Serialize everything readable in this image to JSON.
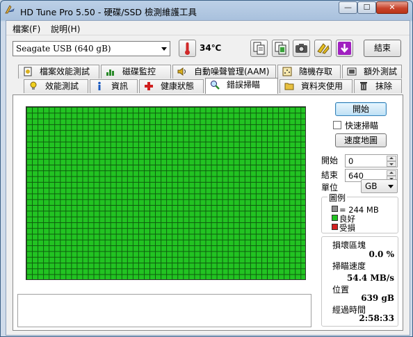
{
  "window": {
    "title": "HD Tune Pro 5.50 - 硬碟/SSD 檢測維護工具",
    "min_glyph": "—",
    "max_glyph": "☐",
    "close_glyph": "✕"
  },
  "menu": {
    "file": "檔案(F)",
    "help": "說明(H)"
  },
  "toolbar": {
    "drive": "Seagate USB (640 gB)",
    "temperature": "34℃",
    "exit": "結束",
    "icons": [
      "thermometer-icon",
      "copy-info-icon",
      "copy-screen-icon",
      "camera-icon",
      "options-icon",
      "download-icon"
    ]
  },
  "tabs": {
    "row_back": [
      "檔案效能測試",
      "磁碟監控",
      "自動噪聲管理(AAM)",
      "隨機存取",
      "額外測試"
    ],
    "row_front": [
      "效能測試",
      "資訊",
      "健康狀態",
      "錯誤掃瞄",
      "資料夾使用",
      "抹除"
    ],
    "active": "錯誤掃瞄"
  },
  "scan": {
    "start_button": "開始",
    "quick_scan_label": "快速掃瞄",
    "quick_scan_checked": false,
    "speed_map_button": "速度地圖",
    "start_label": "開始",
    "start_value": "0",
    "end_label": "結束",
    "end_value": "640",
    "unit_label": "單位",
    "unit_value": "GB",
    "legend_title": "圖例",
    "legend": [
      {
        "label": "= 244 MB",
        "color": "#909090"
      },
      {
        "label": "良好",
        "color": "#22c322"
      },
      {
        "label": "受損",
        "color": "#d42020"
      }
    ],
    "grid_color": "#22c322",
    "damaged_label": "損壞區塊",
    "damaged_value": "0.0 %",
    "speed_label": "掃瞄速度",
    "speed_value": "54.4 MB/s",
    "position_label": "位置",
    "position_value": "639 gB",
    "elapsed_label": "經過時間",
    "elapsed_value": "2:58:33"
  }
}
